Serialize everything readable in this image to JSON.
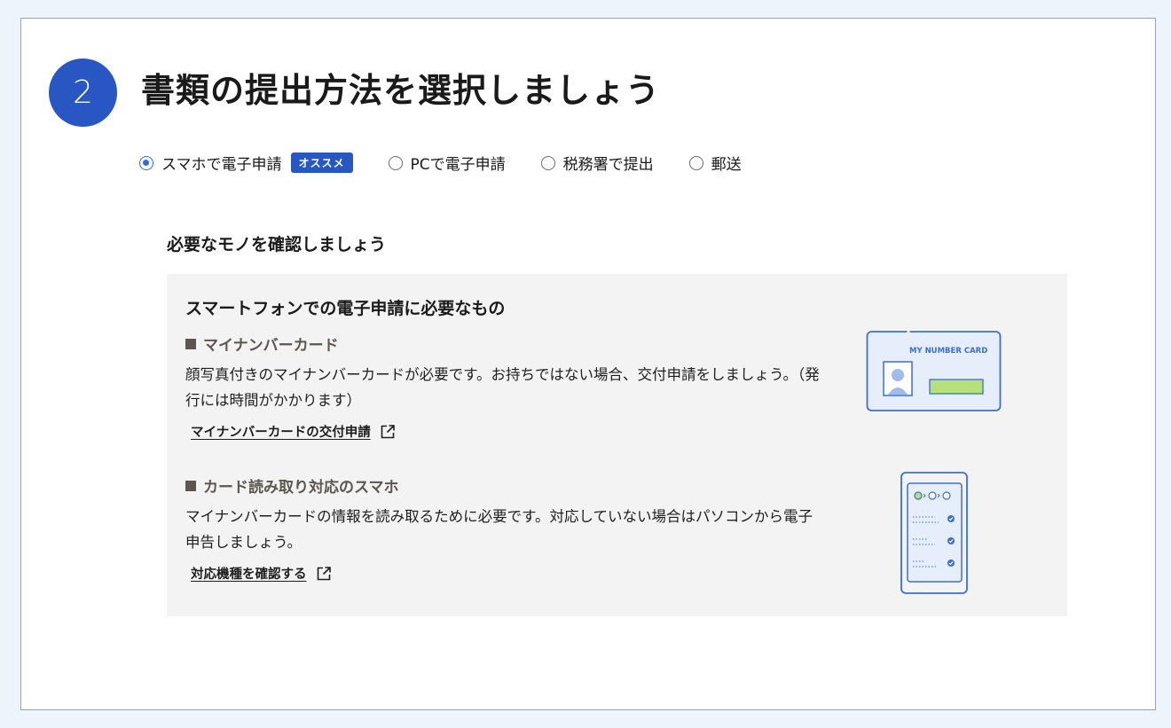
{
  "step": {
    "number": "2",
    "title": "書類の提出方法を選択しましょう"
  },
  "submission_methods": [
    {
      "label": "スマホで電子申請",
      "selected": true,
      "badge": "オススメ"
    },
    {
      "label": "PCで電子申請",
      "selected": false
    },
    {
      "label": "税務署で提出",
      "selected": false
    },
    {
      "label": "郵送",
      "selected": false
    }
  ],
  "requirements": {
    "heading": "必要なモノを確認しましょう",
    "box_title": "スマートフォンでの電子申請に必要なもの",
    "items": [
      {
        "heading": "マイナンバーカード",
        "description": "顔写真付きのマイナンバーカードが必要です。お持ちではない場合、交付申請をしましょう。（発行には時間がかかります）",
        "link": "マイナンバーカードの交付申請"
      },
      {
        "heading": "カード読み取り対応のスマホ",
        "description": "マイナンバーカードの情報を読み取るために必要です。対応していない場合はパソコンから電子申告しましょう。",
        "link": "対応機種を確認する"
      }
    ],
    "card_illustration_text": "MY NUMBER CARD"
  },
  "colors": {
    "accent": "#2857c4",
    "radio_selected": "#2f6fd6",
    "box_background": "#f4f3f3",
    "illustration_line": "#3b6fd3",
    "illustration_fill": "#e6eefb",
    "card_stripe": "#b5e07a"
  },
  "icons": {
    "external_link": "external-link-icon"
  }
}
